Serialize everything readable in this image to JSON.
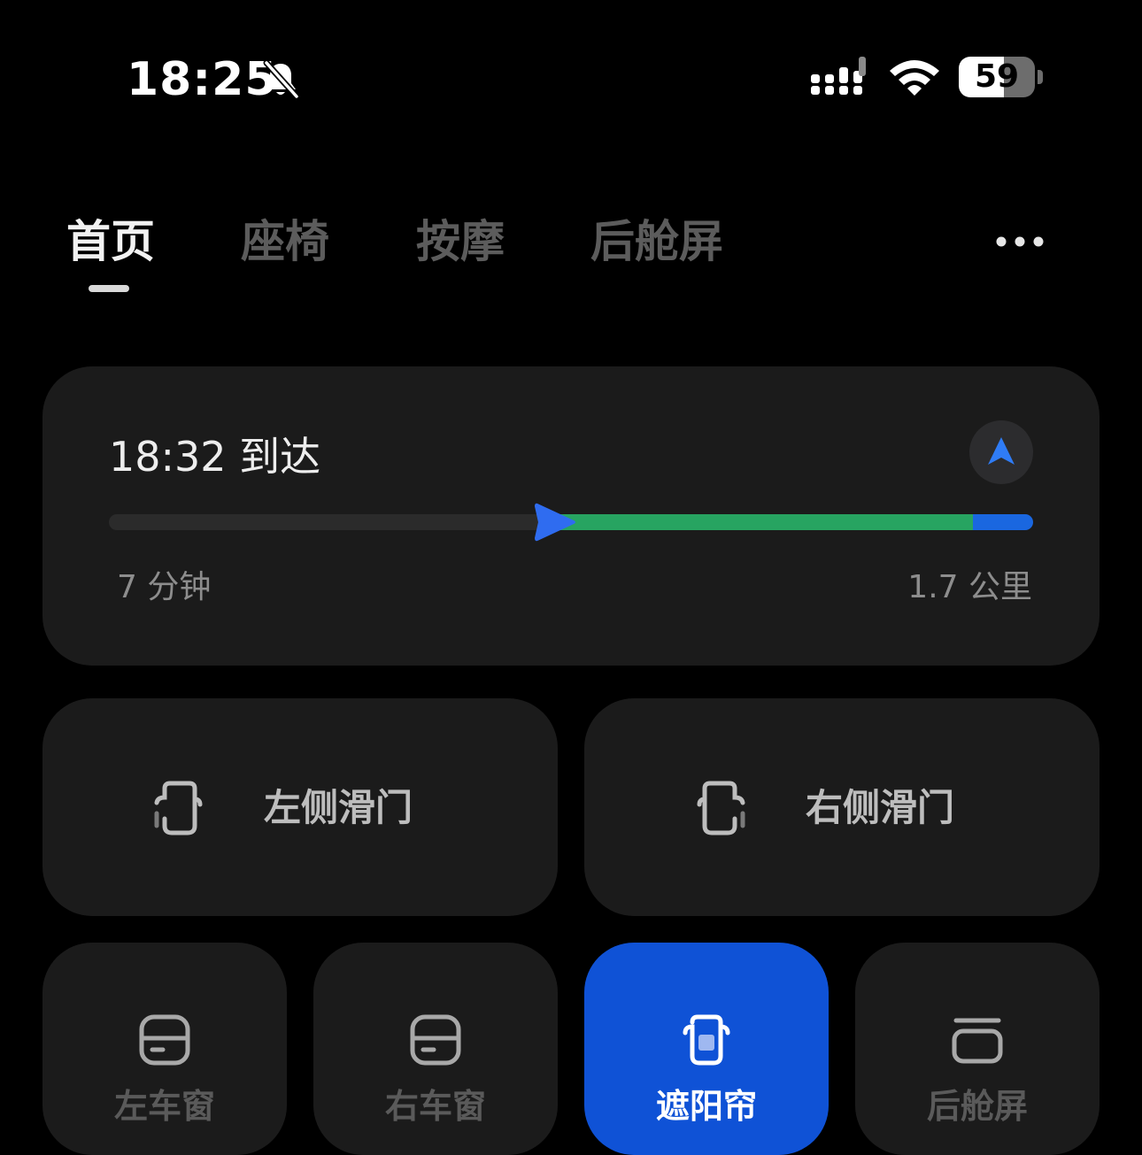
{
  "status_bar": {
    "time": "18:25",
    "battery_percent": "59",
    "battery_level": 0.59
  },
  "tabs": [
    {
      "label": "首页",
      "active": true
    },
    {
      "label": "座椅",
      "active": false
    },
    {
      "label": "按摩",
      "active": false
    },
    {
      "label": "后舱屏",
      "active": false
    }
  ],
  "navigation": {
    "eta": "18:32 到达",
    "remaining_time": "7 分钟",
    "remaining_distance": "1.7 公里",
    "progress": 0.48,
    "green_until": 0.935
  },
  "doors": {
    "left_label": "左侧滑门",
    "right_label": "右侧滑门"
  },
  "controls": [
    {
      "label": "左车窗",
      "icon": "window-icon",
      "active": false
    },
    {
      "label": "右车窗",
      "icon": "window-icon",
      "active": false
    },
    {
      "label": "遮阳帘",
      "icon": "sunshade-icon",
      "active": true
    },
    {
      "label": "后舱屏",
      "icon": "rear-screen-icon",
      "active": false
    }
  ],
  "colors": {
    "accent_blue": "#0f52d6",
    "route_green": "#27a461",
    "route_blue": "#1a67e0",
    "card_bg": "#1b1b1b"
  }
}
